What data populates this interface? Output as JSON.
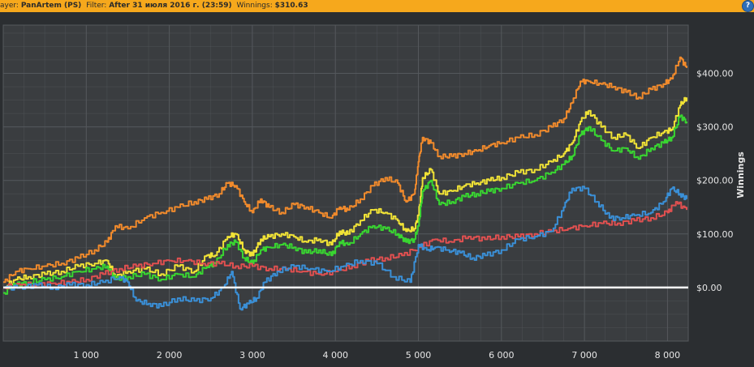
{
  "header": {
    "player_label": "ayer:",
    "player_value": "PanArtem (PS)",
    "filter_label": "Filter:",
    "filter_value": "After 31 июля 2016 г. (23:59)",
    "winnings_label": "Winnings:",
    "winnings_value": "$310.63",
    "help_icon": "?"
  },
  "colors": {
    "background": "#2b2e31",
    "plot_background": "#3a3d40",
    "grid": "#55595d",
    "zero_line": "#ffffff",
    "text": "#e6e6e6",
    "header_bg": "#f6a81c"
  },
  "chart_data": {
    "type": "line",
    "ylabel": "Winnings",
    "xlim": [
      0,
      8250
    ],
    "ylim": [
      -100,
      490
    ],
    "x_ticks": [
      1000,
      2000,
      3000,
      4000,
      5000,
      6000,
      7000,
      8000
    ],
    "x_tick_labels": [
      "1 000",
      "2 000",
      "3 000",
      "4 000",
      "5 000",
      "6 000",
      "7 000",
      "8 000"
    ],
    "y_ticks": [
      0,
      100,
      200,
      300,
      400
    ],
    "y_tick_labels": [
      "$0.00",
      "$100.00",
      "$200.00",
      "$300.00",
      "$400.00"
    ],
    "grid": true,
    "zero_line": 0,
    "series": [
      {
        "color": "#f08a2c",
        "x": [
          0,
          150,
          300,
          500,
          700,
          900,
          1100,
          1250,
          1350,
          1500,
          1700,
          1900,
          2100,
          2300,
          2450,
          2600,
          2700,
          2800,
          2900,
          3000,
          3100,
          3200,
          3350,
          3500,
          3650,
          3800,
          3950,
          4050,
          4150,
          4300,
          4450,
          4600,
          4750,
          4850,
          4950,
          5000,
          5050,
          5150,
          5250,
          5400,
          5550,
          5700,
          5850,
          6000,
          6200,
          6400,
          6600,
          6750,
          6850,
          6950,
          7050,
          7200,
          7350,
          7500,
          7650,
          7800,
          7950,
          8050,
          8150,
          8230
        ],
        "y": [
          10,
          30,
          35,
          40,
          45,
          55,
          70,
          85,
          115,
          110,
          130,
          140,
          150,
          160,
          165,
          175,
          195,
          190,
          160,
          140,
          165,
          150,
          140,
          155,
          150,
          140,
          130,
          150,
          145,
          165,
          190,
          205,
          195,
          160,
          175,
          235,
          280,
          270,
          245,
          245,
          250,
          255,
          265,
          270,
          280,
          285,
          300,
          315,
          345,
          385,
          385,
          380,
          375,
          365,
          355,
          370,
          380,
          390,
          430,
          410
        ]
      },
      {
        "color": "#f0e236",
        "x": [
          0,
          150,
          300,
          500,
          700,
          900,
          1100,
          1250,
          1350,
          1500,
          1700,
          1900,
          2100,
          2300,
          2450,
          2550,
          2700,
          2800,
          2900,
          3000,
          3100,
          3200,
          3350,
          3500,
          3650,
          3800,
          3950,
          4050,
          4150,
          4300,
          4450,
          4600,
          4750,
          4850,
          4950,
          5000,
          5050,
          5150,
          5250,
          5400,
          5550,
          5700,
          5850,
          6000,
          6200,
          6400,
          6600,
          6750,
          6850,
          6950,
          7050,
          7200,
          7350,
          7500,
          7650,
          7800,
          7950,
          8050,
          8150,
          8230
        ],
        "y": [
          0,
          15,
          20,
          25,
          30,
          40,
          45,
          50,
          20,
          30,
          35,
          25,
          40,
          30,
          60,
          60,
          95,
          100,
          70,
          60,
          90,
          95,
          100,
          95,
          85,
          90,
          80,
          105,
          100,
          125,
          145,
          140,
          125,
          105,
          110,
          135,
          205,
          220,
          175,
          180,
          190,
          195,
          200,
          205,
          215,
          220,
          235,
          250,
          270,
          310,
          330,
          300,
          280,
          285,
          260,
          280,
          290,
          295,
          340,
          355
        ]
      },
      {
        "color": "#39d531",
        "x": [
          0,
          150,
          300,
          500,
          700,
          900,
          1100,
          1250,
          1350,
          1500,
          1700,
          1900,
          2100,
          2300,
          2450,
          2550,
          2700,
          2800,
          2900,
          3000,
          3100,
          3200,
          3350,
          3500,
          3650,
          3800,
          3950,
          4050,
          4150,
          4300,
          4450,
          4600,
          4750,
          4850,
          4950,
          5000,
          5050,
          5150,
          5250,
          5400,
          5550,
          5700,
          5850,
          6000,
          6200,
          6400,
          6600,
          6750,
          6850,
          6950,
          7050,
          7200,
          7350,
          7500,
          7650,
          7800,
          7950,
          8050,
          8150,
          8230
        ],
        "y": [
          -10,
          5,
          10,
          15,
          20,
          30,
          35,
          40,
          15,
          20,
          25,
          15,
          25,
          20,
          40,
          45,
          80,
          85,
          55,
          45,
          70,
          75,
          80,
          75,
          65,
          70,
          60,
          85,
          80,
          100,
          115,
          110,
          100,
          85,
          90,
          115,
          180,
          200,
          155,
          160,
          170,
          175,
          180,
          185,
          195,
          200,
          215,
          230,
          245,
          285,
          300,
          275,
          255,
          260,
          240,
          260,
          270,
          280,
          320,
          310
        ]
      },
      {
        "color": "#e05050",
        "x": [
          0,
          200,
          400,
          600,
          800,
          1000,
          1200,
          1400,
          1600,
          1800,
          2000,
          2200,
          2400,
          2600,
          2800,
          3000,
          3200,
          3400,
          3600,
          3800,
          4000,
          4200,
          4400,
          4600,
          4800,
          5000,
          5200,
          5400,
          5600,
          5800,
          6000,
          6200,
          6400,
          6600,
          6800,
          7000,
          7200,
          7400,
          7600,
          7800,
          8000,
          8100,
          8230
        ],
        "y": [
          0,
          5,
          5,
          8,
          10,
          15,
          25,
          35,
          40,
          45,
          50,
          50,
          45,
          45,
          40,
          40,
          35,
          35,
          30,
          25,
          30,
          40,
          50,
          55,
          60,
          75,
          90,
          85,
          95,
          90,
          95,
          95,
          100,
          105,
          110,
          115,
          120,
          120,
          125,
          130,
          140,
          160,
          145
        ]
      },
      {
        "color": "#3a8fd6",
        "x": [
          0,
          200,
          400,
          600,
          800,
          1000,
          1200,
          1400,
          1500,
          1600,
          1750,
          1900,
          2100,
          2300,
          2500,
          2650,
          2750,
          2850,
          2950,
          3050,
          3150,
          3300,
          3500,
          3700,
          3900,
          4100,
          4300,
          4500,
          4700,
          4900,
          5000,
          5100,
          5200,
          5350,
          5500,
          5650,
          5800,
          6000,
          6200,
          6400,
          6600,
          6750,
          6850,
          7000,
          7150,
          7300,
          7450,
          7600,
          7800,
          7950,
          8050,
          8150,
          8230
        ],
        "y": [
          0,
          0,
          5,
          0,
          5,
          5,
          10,
          20,
          10,
          -25,
          -30,
          -35,
          -20,
          -25,
          -20,
          0,
          30,
          -40,
          -30,
          -20,
          10,
          30,
          40,
          35,
          30,
          40,
          50,
          45,
          20,
          10,
          80,
          70,
          75,
          70,
          65,
          55,
          60,
          70,
          90,
          95,
          105,
          150,
          185,
          185,
          160,
          130,
          130,
          135,
          140,
          160,
          185,
          175,
          165
        ]
      }
    ]
  }
}
